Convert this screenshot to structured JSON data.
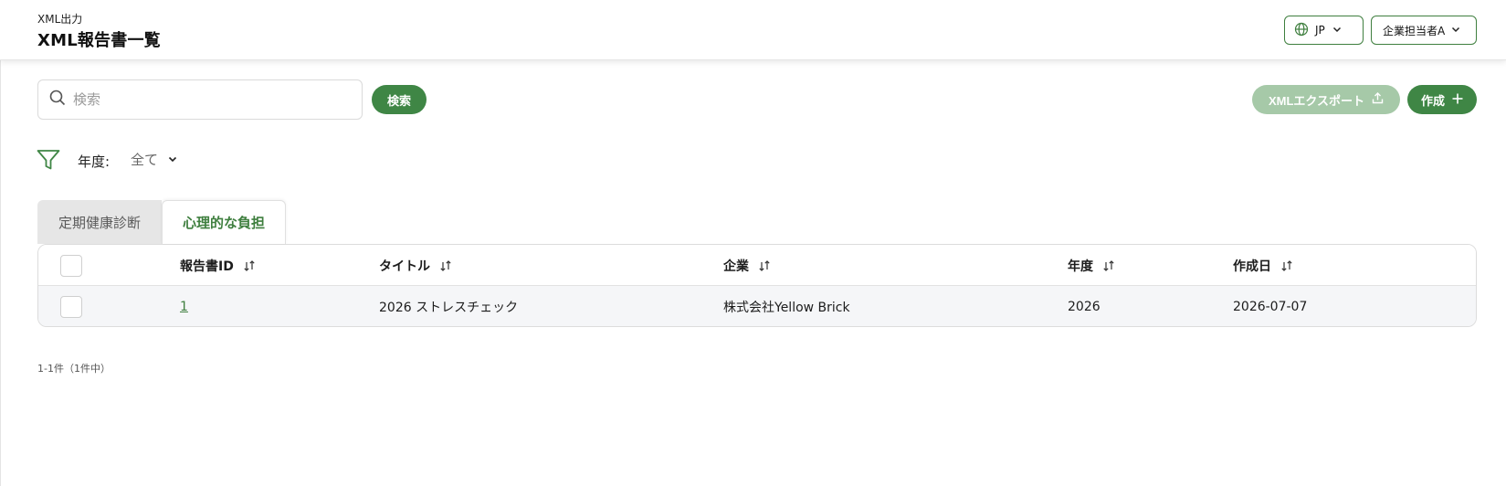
{
  "header": {
    "breadcrumb": "XML出力",
    "title": "XML報告書一覧",
    "language": {
      "label": "JP",
      "icon": "globe-icon"
    },
    "user": {
      "label": "企業担当者A"
    }
  },
  "toolbar": {
    "search": {
      "placeholder": "検索",
      "value": ""
    },
    "search_label": "検索",
    "export_label": "XMLエクスポート",
    "export_enabled": false,
    "create_label": "作成"
  },
  "filter": {
    "label": "年度:",
    "selected": "全て"
  },
  "tabs": [
    {
      "label": "定期健康診断",
      "active": false
    },
    {
      "label": "心理的な負担",
      "active": true
    }
  ],
  "table": {
    "columns": [
      "報告書ID",
      "タイトル",
      "企業",
      "年度",
      "作成日"
    ],
    "rows": [
      {
        "id": "1",
        "title": "2026 ストレスチェック",
        "company": "株式会社Yellow Brick",
        "year": "2026",
        "created": "2026-07-07"
      }
    ]
  },
  "pagination": {
    "summary": "1-1件（1件中）"
  },
  "colors": {
    "accent": "#3f8645",
    "accent_disabled": "#a6c9a8",
    "link": "#3f7f3f",
    "row_bg": "#f5f6f8",
    "tab_inactive_bg": "#e6e6e6"
  }
}
